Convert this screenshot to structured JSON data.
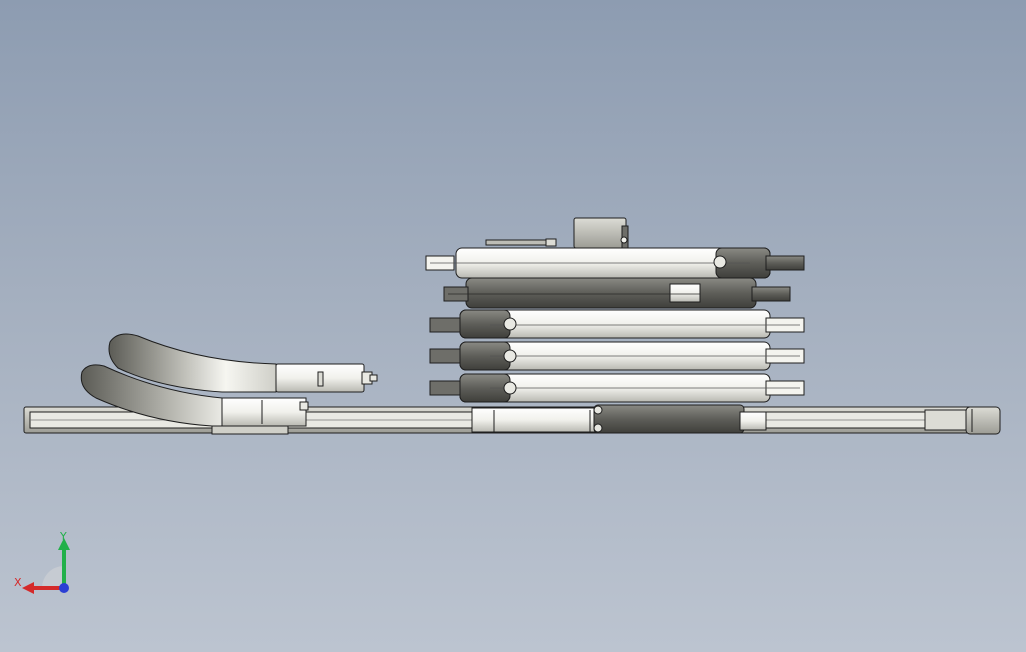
{
  "viewport": {
    "background_top": "#8d9cb1",
    "background_bottom": "#bcc4d0"
  },
  "colors": {
    "part_light": "#f4f4ef",
    "part_mid": "#c9c9c2",
    "part_dark": "#6e6e69",
    "part_darker": "#55554f",
    "edge": "#1e1e1e",
    "axis_x": "#d42a2a",
    "axis_y": "#22b04a",
    "axis_z": "#2b3fd4"
  },
  "triad": {
    "x_label": "X",
    "y_label": "Y",
    "icons": [
      "coordinate-triad-icon"
    ]
  }
}
